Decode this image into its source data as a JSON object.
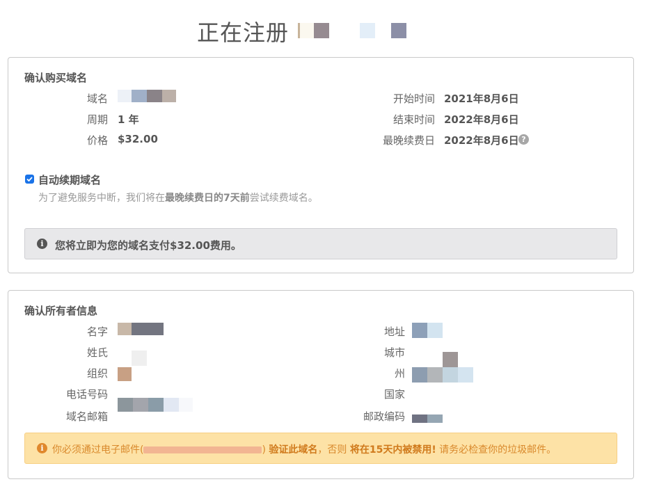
{
  "page": {
    "title": "正在注册"
  },
  "domain_card": {
    "title": "确认购买域名",
    "labels": {
      "domain": "域名",
      "period": "周期",
      "price": "价格",
      "start": "开始时间",
      "end": "结束时间",
      "latest_renew": "最晚续费日"
    },
    "values": {
      "period": "1 年",
      "price": "$32.00",
      "start": "2021年8月6日",
      "end": "2022年8月6日",
      "latest_renew": "2022年8月6日"
    },
    "help_icon": "question-circle-icon",
    "auto_renew": {
      "checked": true,
      "label": "自动续期域名",
      "note_pre": "为了避免服务中断，我们将在",
      "note_bold1": "最晚续费日的7天前",
      "note_post": "尝试续费域名。"
    },
    "info_alert": {
      "icon": "info-circle-icon",
      "text": "您将立即为您的域名支付$32.00费用。"
    }
  },
  "owner_card": {
    "title": "确认所有者信息",
    "labels": {
      "name": "名字",
      "surname": "姓氏",
      "org": "组织",
      "phone": "电话号码",
      "email": "域名邮箱",
      "address": "地址",
      "city": "城市",
      "state": "州",
      "country": "国家",
      "postcode": "邮政编码"
    },
    "warn_alert": {
      "icon": "info-circle-icon",
      "pre": "你必须通过电子邮件(",
      "post": ")",
      "bold1": "验证此域名",
      "mid": "，否则",
      "bold2": "将在15天内被禁用!",
      "tail": "请务必检查你的垃圾邮件。"
    }
  },
  "colors": {
    "checkbox": "#1a73e8",
    "arrow": "#e8141c",
    "warn_text": "#d9892c",
    "warn_bg": "#fde2a6",
    "info_bg": "#e8e8ea"
  }
}
